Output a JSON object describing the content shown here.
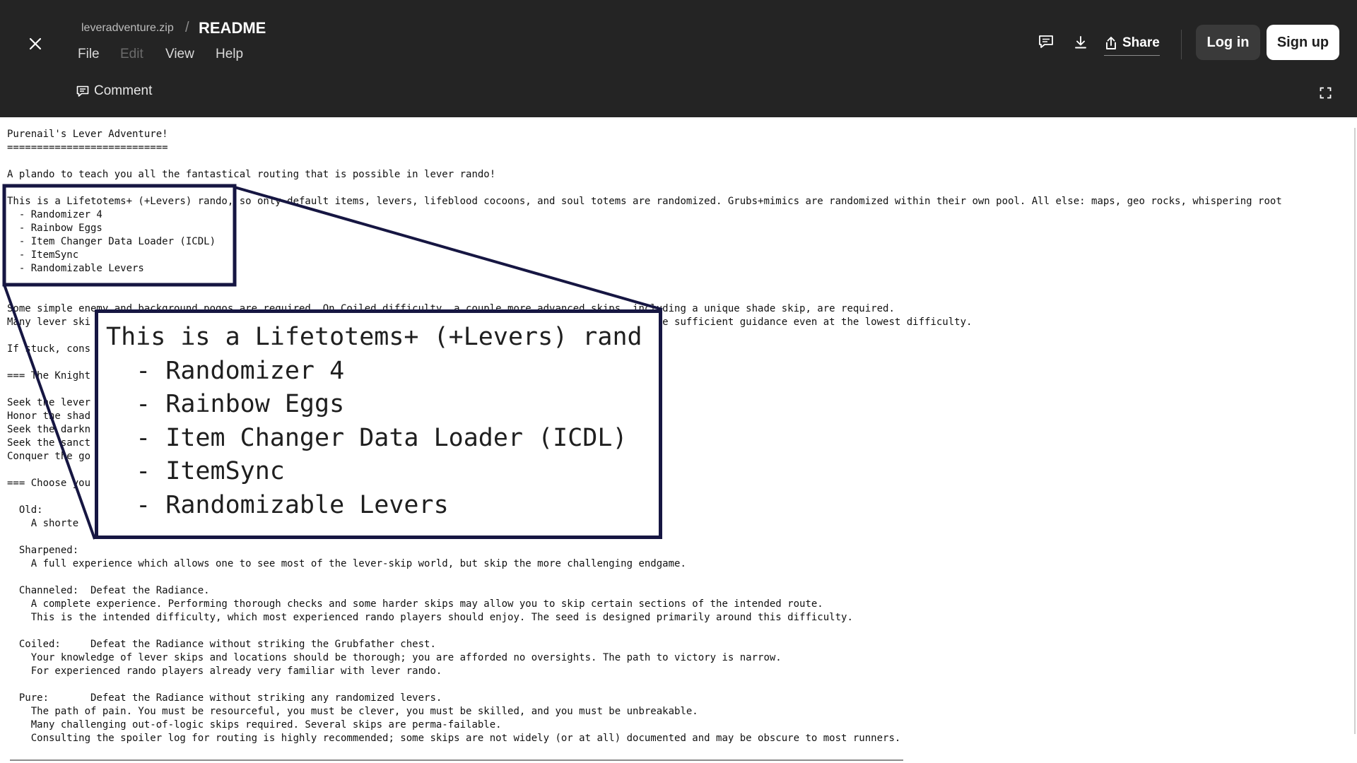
{
  "header": {
    "file_name": "leveradventure.zip",
    "separator": "/",
    "title": "README",
    "menu": [
      "File",
      "Edit",
      "View",
      "Help"
    ],
    "share_label": "Share",
    "login_label": "Log in",
    "signup_label": "Sign up",
    "comment_label": "Comment"
  },
  "document": {
    "lines": [
      "Purenail's Lever Adventure!",
      "===========================",
      "",
      "A plando to teach you all the fantastical routing that is possible in lever rando!",
      "",
      "This is a Lifetotems+ (+Levers) rando, so only default items, levers, lifeblood cocoons, and soul totems are randomized. Grubs+mimics are randomized within their own pool. All else: maps, geo rocks, whispering root",
      "  - Randomizer 4",
      "  - Rainbow Eggs",
      "  - Item Changer Data Loader (ICDL)",
      "  - ItemSync",
      "  - Randomizable Levers",
      "",
      "",
      "Some simple enemy and background pogos are required. On Coiled difficulty, a couple more advanced skips, including a unique shade skip, are required.",
      "Many lever ski                                                            d in logic, so helper log will not be sufficient guidance even at the lowest difficulty.",
      "",
      "If stuck, cons",
      "",
      "=== The Knight",
      "",
      "Seek the lever",
      "Honor the shad",
      "Seek the darkn",
      "Seek the sanct",
      "Conquer the go",
      "",
      "=== Choose you",
      "",
      "  Old:",
      "    A shorte",
      "",
      "  Sharpened:",
      "    A full experience which allows one to see most of the lever-skip world, but skip the more challenging endgame.",
      "",
      "  Channeled:  Defeat the Radiance.",
      "    A complete experience. Performing thorough checks and some harder skips may allow you to skip certain sections of the intended route.",
      "    This is the intended difficulty, which most experienced rando players should enjoy. The seed is designed primarily around this difficulty.",
      "",
      "  Coiled:     Defeat the Radiance without striking the Grubfather chest.",
      "    Your knowledge of lever skips and locations should be thorough; you are afforded no oversights. The path to victory is narrow.",
      "    For experienced rando players already very familiar with lever rando.",
      "",
      "  Pure:       Defeat the Radiance without striking any randomized levers.",
      "    The path of pain. You must be resourceful, you must be clever, you must be skilled, and you must be unbreakable.",
      "    Many challenging out-of-logic skips required. Several skips are perma-failable.",
      "    Consulting the spoiler log for routing is highly recommended; some skips are not widely (or at all) documented and may be obscure to most runners."
    ]
  },
  "zoom": {
    "lines": [
      "This is a Lifetotems+ (+Levers) rand",
      "  - Randomizer 4",
      "  - Rainbow Eggs",
      "  - Item Changer Data Loader (ICDL)",
      "  - ItemSync",
      "  - Randomizable Levers"
    ]
  },
  "colors": {
    "header_bg": "#242424",
    "callout_border": "#161642",
    "signup_bg": "#ffffff",
    "login_bg": "#3a3a3a"
  },
  "icons": [
    "close-icon",
    "comment-icon",
    "download-icon",
    "share-icon",
    "fullscreen-icon"
  ]
}
